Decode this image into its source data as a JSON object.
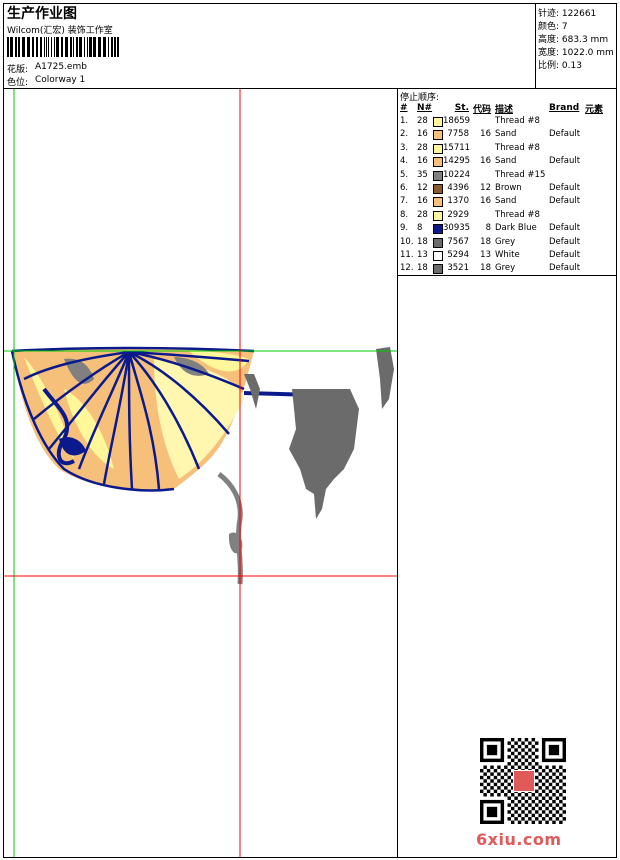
{
  "header": {
    "title": "生产作业图",
    "company": "Wilcom(汇宏) 装饰工作室",
    "design_label": "花版:",
    "design_value": "A1725.emb",
    "colorway_label": "色位:",
    "colorway_value": "Colorway 1"
  },
  "stats": [
    {
      "label": "针迹:",
      "value": "122661"
    },
    {
      "label": "颜色:",
      "value": "7"
    },
    {
      "label": "高度:",
      "value": "683.3 mm"
    },
    {
      "label": "宽度:",
      "value": "1022.0 mm"
    },
    {
      "label": "比例:",
      "value": "0.13"
    }
  ],
  "thread_table": {
    "title": "停止顺序:",
    "headers": [
      "#",
      "N#",
      "St.",
      "代码",
      "描述",
      "Brand",
      "元素"
    ],
    "rows": [
      {
        "idx": "1.",
        "n": "28",
        "color": "#fff799",
        "st": "18659",
        "code": "",
        "desc": "Thread #8",
        "brand": ""
      },
      {
        "idx": "2.",
        "n": "16",
        "color": "#f7c07a",
        "st": "7758",
        "code": "16",
        "desc": "Sand",
        "brand": "Default"
      },
      {
        "idx": "3.",
        "n": "28",
        "color": "#fff799",
        "st": "15711",
        "code": "",
        "desc": "Thread #8",
        "brand": ""
      },
      {
        "idx": "4.",
        "n": "16",
        "color": "#f7c07a",
        "st": "14295",
        "code": "16",
        "desc": "Sand",
        "brand": "Default"
      },
      {
        "idx": "5.",
        "n": "35",
        "color": "#808080",
        "st": "10224",
        "code": "",
        "desc": "Thread #15",
        "brand": ""
      },
      {
        "idx": "6.",
        "n": "12",
        "color": "#8b5a2b",
        "st": "4396",
        "code": "12",
        "desc": "Brown",
        "brand": "Default"
      },
      {
        "idx": "7.",
        "n": "16",
        "color": "#f7c07a",
        "st": "1370",
        "code": "16",
        "desc": "Sand",
        "brand": "Default"
      },
      {
        "idx": "8.",
        "n": "28",
        "color": "#fff799",
        "st": "2929",
        "code": "",
        "desc": "Thread #8",
        "brand": ""
      },
      {
        "idx": "9.",
        "n": "8",
        "color": "#0a1a8c",
        "st": "30935",
        "code": "8",
        "desc": "Dark Blue",
        "brand": "Default"
      },
      {
        "idx": "10.",
        "n": "18",
        "color": "#6b6b6b",
        "st": "7567",
        "code": "18",
        "desc": "Grey",
        "brand": "Default"
      },
      {
        "idx": "11.",
        "n": "13",
        "color": "#ffffff",
        "st": "5294",
        "code": "13",
        "desc": "White",
        "brand": "Default"
      },
      {
        "idx": "12.",
        "n": "18",
        "color": "#6b6b6b",
        "st": "3521",
        "code": "18",
        "desc": "Grey",
        "brand": "Default"
      }
    ]
  },
  "watermark": "6xiu.com",
  "colors": {
    "guide_red": "#ff0000",
    "guide_green": "#00cc00",
    "stitch_blue": "#0a1a8c",
    "sand": "#f7c07a",
    "yellow": "#fff799",
    "grey": "#6b6b6b"
  }
}
